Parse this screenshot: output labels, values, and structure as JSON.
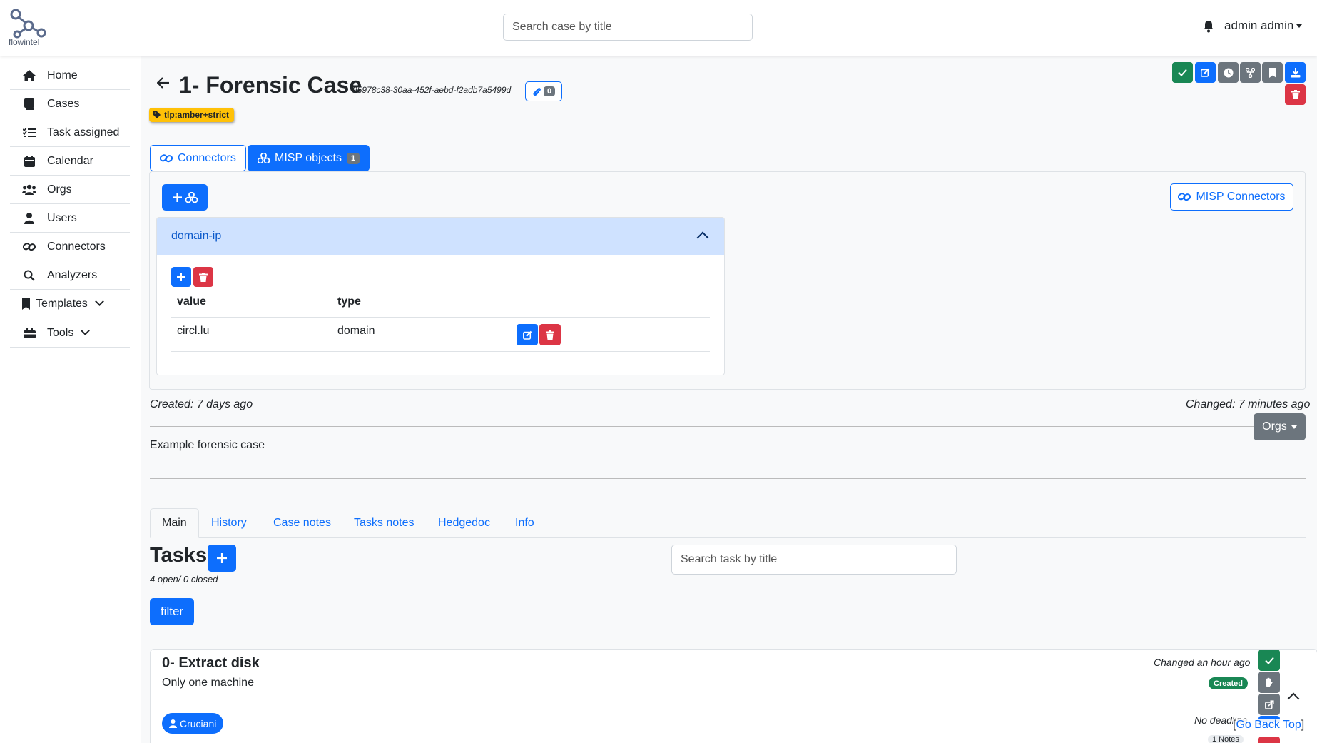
{
  "app": {
    "logo_text": "flowintel"
  },
  "search": {
    "placeholder": "Search case by title"
  },
  "user": {
    "name": "admin admin"
  },
  "sidebar": {
    "items": [
      {
        "label": "Home",
        "icon": "home-icon"
      },
      {
        "label": "Cases",
        "icon": "book-icon"
      },
      {
        "label": "Task assigned",
        "icon": "list-check-icon"
      },
      {
        "label": "Calendar",
        "icon": "calendar-icon"
      },
      {
        "label": "Orgs",
        "icon": "users-icon"
      },
      {
        "label": "Users",
        "icon": "user-icon"
      },
      {
        "label": "Connectors",
        "icon": "link-icon"
      },
      {
        "label": "Analyzers",
        "icon": "search-icon"
      },
      {
        "label": "Templates",
        "icon": "bookmark-icon"
      },
      {
        "label": "Tools",
        "icon": "toolbox-icon"
      }
    ]
  },
  "case": {
    "title": "1- Forensic Case",
    "uuid": "95978c38-30aa-452f-aebd-f2adb7a5499d",
    "attachments": "0",
    "tag": "tlp:amber+strict",
    "created": "Created: 7 days ago",
    "changed": "Changed: 7 minutes ago",
    "description": "Example forensic case",
    "orgs_label": "Orgs"
  },
  "case_tabs": {
    "connectors": "Connectors",
    "misp_objects": "MISP objects",
    "misp_objects_count": "1"
  },
  "misp": {
    "connectors_label": "MISP Connectors",
    "object_name": "domain-ip",
    "columns": [
      "value",
      "type"
    ],
    "rows": [
      {
        "value": "circl.lu",
        "type": "domain"
      }
    ]
  },
  "nav_tabs": [
    "Main",
    "History",
    "Case notes",
    "Tasks notes",
    "Hedgedoc",
    "Info"
  ],
  "tasks": {
    "title": "Tasks",
    "count_text": "4 open/ 0 closed",
    "search_placeholder": "Search task by title",
    "filter_label": "filter",
    "items": [
      {
        "title": "0- Extract disk",
        "description": "Only one machine",
        "changed": "Changed an hour ago",
        "status": "Created",
        "user": "Cruciani",
        "deadline": "No deadline",
        "notes": "1 Notes"
      }
    ]
  },
  "footer": {
    "go_back_top": "Go Back Top"
  },
  "colors": {
    "primary": "#0d6efd",
    "success": "#198754",
    "danger": "#dc3545",
    "secondary": "#6c757d",
    "warning": "#ffc107"
  }
}
